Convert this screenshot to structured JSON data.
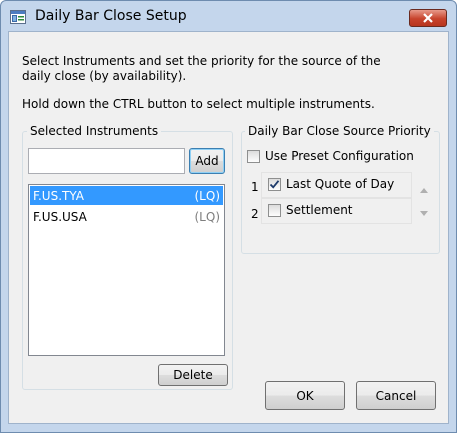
{
  "window": {
    "title": "Daily Bar Close Setup",
    "close_glyph": "✕"
  },
  "instructions": {
    "line1": "Select Instruments and set the priority for the source of the",
    "line2": "daily close (by availability).",
    "line3": "Hold down the CTRL button to select multiple instruments."
  },
  "instruments": {
    "group_label": "Selected Instruments",
    "input_value": "",
    "add_label": "Add",
    "items": [
      {
        "code": "F.US.TYA",
        "tag": "(LQ)",
        "selected": true
      },
      {
        "code": "F.US.USA",
        "tag": "(LQ)",
        "selected": false
      }
    ],
    "delete_label": "Delete"
  },
  "priority": {
    "group_label": "Daily Bar Close Source Priority",
    "use_preset_label": "Use Preset Configuration",
    "use_preset_checked": false,
    "items": [
      {
        "number": "1",
        "label": "Last Quote of Day",
        "checked": true
      },
      {
        "number": "2",
        "label": "Settlement",
        "checked": false
      }
    ]
  },
  "footer": {
    "ok_label": "OK",
    "cancel_label": "Cancel"
  },
  "icons": {
    "app": "app-window-icon",
    "close": "close-icon",
    "up": "arrow-up-icon",
    "down": "arrow-down-icon",
    "check": "checkmark-icon"
  },
  "colors": {
    "selection": "#3399ff",
    "close_button": "#c7432c",
    "frame": "#c4d6ec"
  }
}
